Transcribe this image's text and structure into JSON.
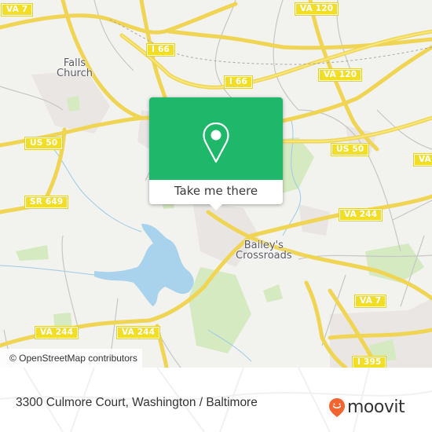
{
  "map": {
    "places": [
      {
        "id": "falls-church",
        "label": "Falls\nChurch"
      },
      {
        "id": "baileys-crossroads",
        "label": "Bailey's\nCrossroads"
      }
    ],
    "shields": [
      {
        "id": "va-7-nw",
        "label": "VA 7"
      },
      {
        "id": "i-66-west",
        "label": "I 66"
      },
      {
        "id": "i-66-east",
        "label": "I 66"
      },
      {
        "id": "va-120-north",
        "label": "VA 120"
      },
      {
        "id": "va-120-south",
        "label": "VA 120"
      },
      {
        "id": "us-50-west",
        "label": "US 50"
      },
      {
        "id": "us-50-east",
        "label": "US 50"
      },
      {
        "id": "va-east-edge",
        "label": "VA"
      },
      {
        "id": "sr-649",
        "label": "SR 649"
      },
      {
        "id": "va-244-east",
        "label": "VA 244"
      },
      {
        "id": "va-244-west",
        "label": "VA 244"
      },
      {
        "id": "va-244-mid",
        "label": "VA 244"
      },
      {
        "id": "va-7-se",
        "label": "VA 7"
      },
      {
        "id": "i-395",
        "label": "I 395"
      }
    ],
    "attribution": "© OpenStreetMap contributors"
  },
  "popup": {
    "action_label": "Take me there",
    "icon": "map-pin-icon",
    "accent_color": "#1fb86a"
  },
  "footer": {
    "address": "3300 Culmore Court, Washington / Baltimore",
    "logo_text": "moovit",
    "logo_color": "#f26430"
  }
}
